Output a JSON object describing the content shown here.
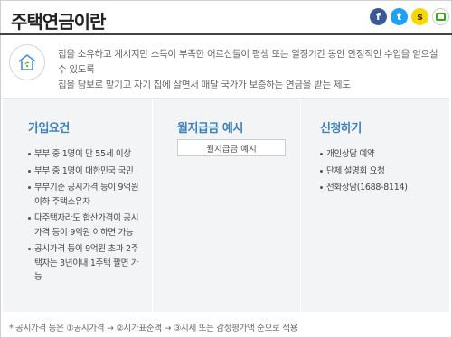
{
  "page": {
    "title": "주택연금이란"
  },
  "share": {
    "icons": [
      "facebook-icon",
      "twitter-icon",
      "kakaostory-icon",
      "gnb-icon"
    ],
    "facebook_glyph": "f",
    "twitter_glyph": "t",
    "kakao_glyph": "s"
  },
  "intro": {
    "line1": "집을 소유하고 계시지만 소득이 부족한 어르신들이 평생 또는 일정기간 동안 안정적인 수입을 얻으실 수 있도록",
    "line2": "집을 담보로 맡기고 자기 집에 살면서 매달 국가가 보증하는 연금을 받는 제도"
  },
  "eligibility": {
    "title": "가입요건",
    "items": [
      "부부 중 1명이 만 55세 이상",
      "부부 중 1명이 대한민국 국민",
      "부부기준 공시가격 등이 9억원 이하 주택소유자",
      "다주택자라도 합산가격이 공시가격 등이 9억원 이하면 가능",
      "공시가격 등이 9억원 초과 2주택자는 3년이내 1주택 팔면 가능"
    ]
  },
  "monthly": {
    "title": "월지급금 예시",
    "button_label": "월지급금 예시"
  },
  "apply": {
    "title": "신청하기",
    "items": [
      "개인상담 예약",
      "단체 설명회 요청",
      "전화상담(1688-8114)"
    ]
  },
  "footnote": "* 공시가격 등은 ①공시가격 → ②시가표준액 → ③시세 또는 감정평가액 순으로 적용",
  "colors": {
    "accent": "#3a7fc1",
    "panel_bg": "#f2f4f6",
    "facebook": "#3b5998",
    "twitter": "#1da1f2",
    "kakao": "#f7d800"
  }
}
